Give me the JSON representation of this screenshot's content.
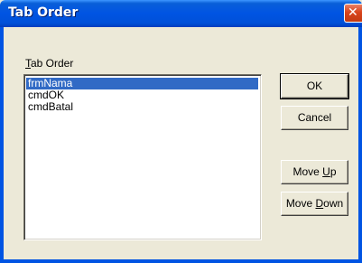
{
  "window": {
    "title": "Tab Order",
    "close_glyph": "✕"
  },
  "tab_order": {
    "label_accel": "T",
    "label_rest": "ab Order",
    "items": [
      {
        "label": "frmNama",
        "selected": true
      },
      {
        "label": "cmdOK",
        "selected": false
      },
      {
        "label": "cmdBatal",
        "selected": false
      }
    ]
  },
  "buttons": {
    "ok": "OK",
    "cancel": "Cancel",
    "move_up_pre": "Move ",
    "move_up_accel": "U",
    "move_up_post": "p",
    "move_down_pre": "Move ",
    "move_down_accel": "D",
    "move_down_post": "own"
  },
  "colors": {
    "titlebar": "#0054e3",
    "dialog_face": "#ece9d8",
    "selection": "#316ac5",
    "close_button": "#d9441c"
  }
}
